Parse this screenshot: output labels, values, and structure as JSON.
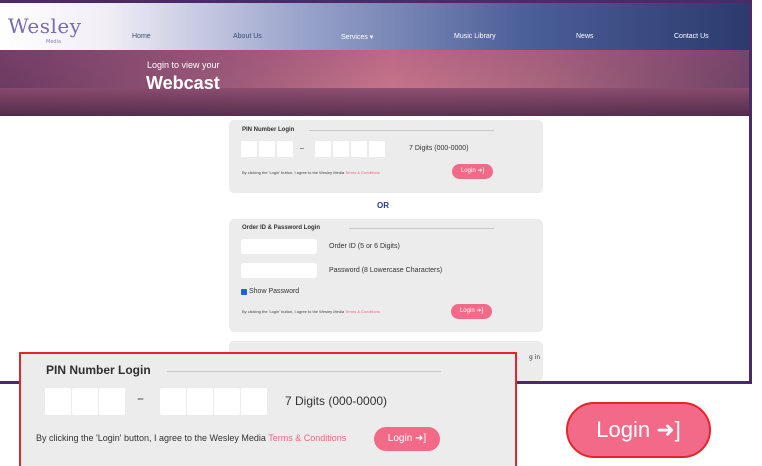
{
  "nav": {
    "logo": "Wesley",
    "logo_sub": "Media",
    "items": [
      "Home",
      "About Us",
      "Services ▾",
      "Music Library",
      "News",
      "Contact Us"
    ]
  },
  "hero": {
    "subtitle": "Login to view your",
    "title": "Webcast"
  },
  "pin_login": {
    "title": "PIN Number Login",
    "separator": "–",
    "hint": "7 Digits (000-0000)",
    "agree_prefix": "By clicking the 'Login' button, I agree to the Wesley Media ",
    "agree_link": "Terms & Conditions",
    "button_label": "Login ➜]"
  },
  "or_label": "OR",
  "order_login": {
    "title": "Order ID & Password Login",
    "order_hint": "Order ID (5 or 6 Digits)",
    "password_hint": "Password (8 Lowercase Characters)",
    "show_password_label": "Show Password",
    "show_password_checked": true,
    "agree_prefix": "By clicking the 'Login' button, I agree to the Wesley Media ",
    "agree_link": "Terms & Conditions",
    "button_label": "Login ➜]"
  },
  "partial_card_text": "g in",
  "zoom_callout": {
    "title": "PIN Number Login",
    "separator": "–",
    "hint": "7 Digits (000-0000)",
    "agree_prefix": "By clicking the 'Login' button, I agree to the Wesley Media ",
    "agree_link": "Terms & Conditions",
    "button_label": "Login ➜]"
  },
  "big_button_label": "Login ➜]",
  "colors": {
    "accent": "#f26a87",
    "highlight_border": "#e3262c",
    "frame": "#4a2a68"
  }
}
